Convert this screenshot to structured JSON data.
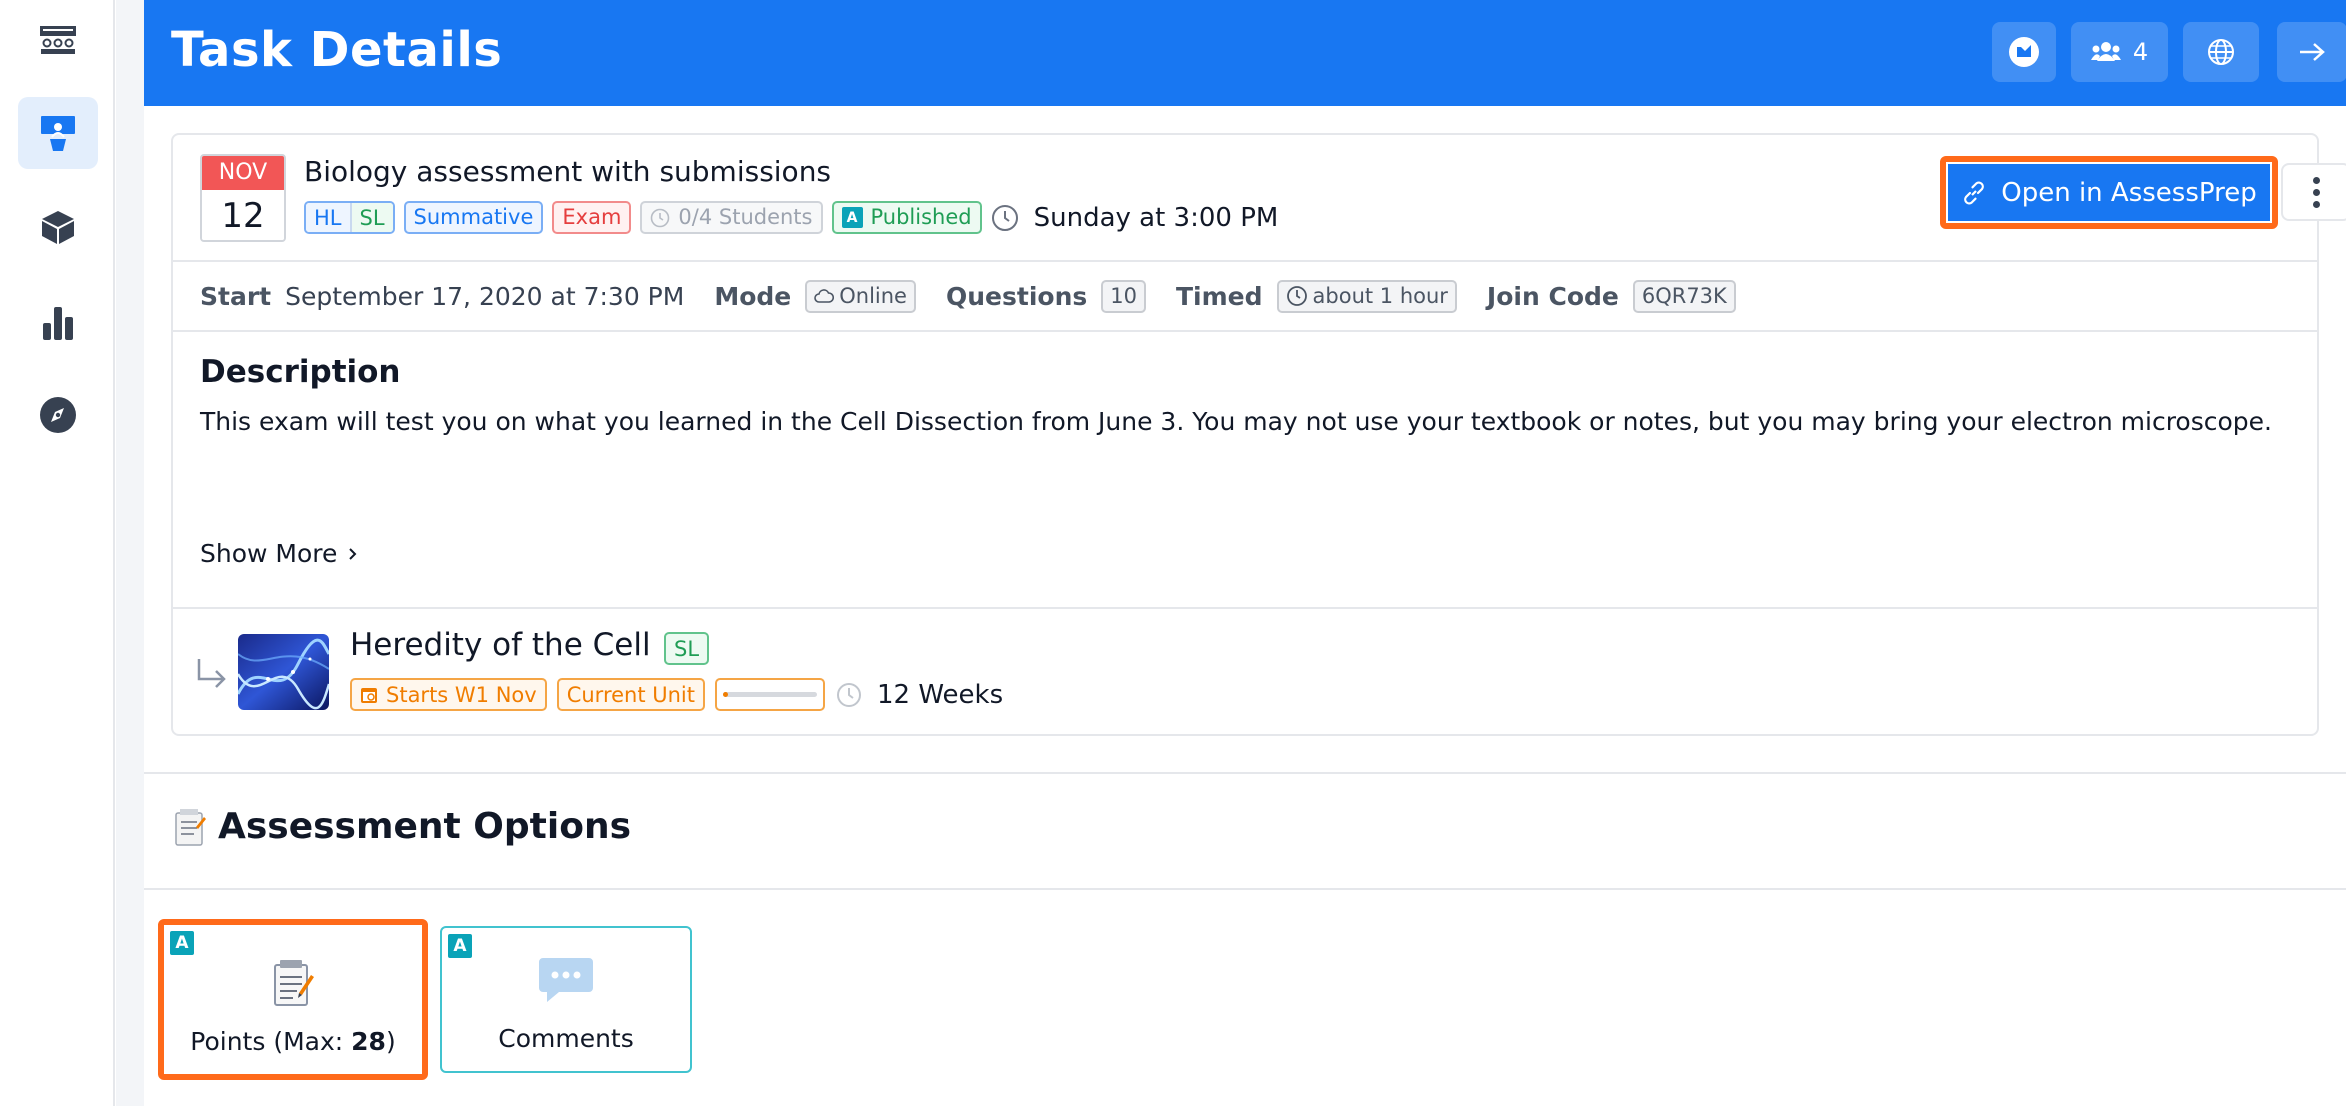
{
  "header": {
    "title": "Task Details",
    "participants_count": "4"
  },
  "task": {
    "month": "NOV",
    "day": "12",
    "title": "Biology assessment with submissions",
    "tags": {
      "hl": "HL",
      "sl": "SL",
      "summative": "Summative",
      "exam": "Exam",
      "students": "0/4 Students",
      "published_letter": "A",
      "published": "Published"
    },
    "due": "Sunday at 3:00 PM",
    "open_button": "Open in AssessPrep"
  },
  "meta": {
    "start_label": "Start",
    "start_value": "September 17, 2020 at 7:30 PM",
    "mode_label": "Mode",
    "mode_value": "Online",
    "questions_label": "Questions",
    "questions_value": "10",
    "timed_label": "Timed",
    "timed_value": "about 1 hour",
    "join_label": "Join Code",
    "join_value": "6QR73K"
  },
  "description": {
    "title": "Description",
    "text": "This exam will test you on what you learned in the Cell Dissection from June 3. You may not use your textbook or notes, but you may bring your electron microscope.",
    "show_more": "Show More"
  },
  "unit": {
    "title": "Heredity of the Cell",
    "level": "SL",
    "starts": "Starts W1 Nov",
    "status": "Current Unit",
    "progress": 0.05,
    "duration": "12 Weeks"
  },
  "assessment_options": {
    "title": "Assessment Options",
    "points_prefix": "Points (Max: ",
    "points_max": "28",
    "points_suffix": ")",
    "comments": "Comments",
    "badge_letter": "A"
  },
  "colors": {
    "primary": "#1877f2",
    "highlight": "#ff6a1a",
    "orange": "#f07d00",
    "teal": "#0aa3b8",
    "red": "#f25656",
    "green": "#1f9d55"
  }
}
